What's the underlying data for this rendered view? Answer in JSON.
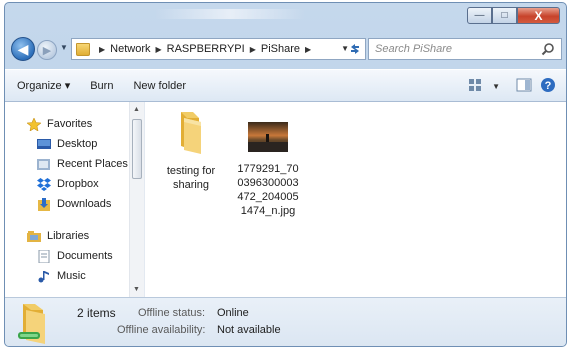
{
  "window": {
    "controls": {
      "minimize": "—",
      "maximize": "□",
      "close": "X"
    }
  },
  "address_bar": {
    "crumbs": [
      "Network",
      "RASPBERRYPI",
      "PiShare"
    ],
    "icon": "network-folder-icon"
  },
  "search": {
    "placeholder": "Search PiShare"
  },
  "toolbar": {
    "organize": "Organize ▾",
    "burn": "Burn",
    "new_folder": "New folder"
  },
  "nav": {
    "favorites_title": "Favorites",
    "favorites": [
      {
        "label": "Desktop",
        "icon": "desktop-icon"
      },
      {
        "label": "Recent Places",
        "icon": "recent-places-icon"
      },
      {
        "label": "Dropbox",
        "icon": "dropbox-icon"
      },
      {
        "label": "Downloads",
        "icon": "downloads-icon"
      }
    ],
    "libraries_title": "Libraries",
    "libraries": [
      {
        "label": "Documents",
        "icon": "documents-icon"
      },
      {
        "label": "Music",
        "icon": "music-icon"
      }
    ]
  },
  "files": [
    {
      "name_lines": [
        "testing for",
        "sharing"
      ],
      "type": "folder"
    },
    {
      "name_lines": [
        "1779291_70",
        "0396300003",
        "472_204005",
        "1474_n.jpg"
      ],
      "type": "image"
    }
  ],
  "status": {
    "count": "2 items",
    "offline_status_label": "Offline status:",
    "offline_status_value": "Online",
    "offline_availability_label": "Offline availability:",
    "offline_availability_value": "Not available"
  },
  "colors": {
    "frame": "#b3cbe5",
    "toolbar": "#dde8f4",
    "close_button": "#c7432b",
    "folder": "#e8b93e"
  }
}
